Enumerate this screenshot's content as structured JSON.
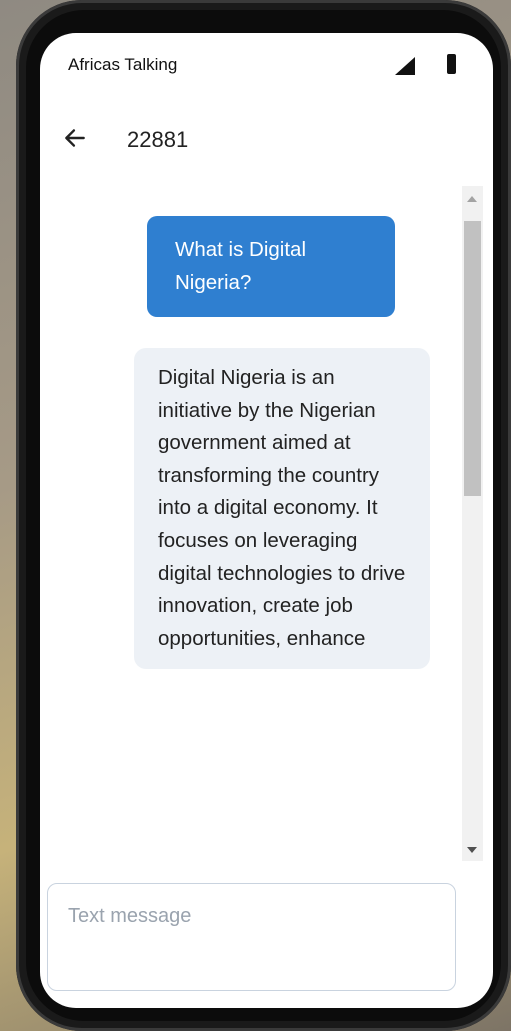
{
  "status_bar": {
    "carrier": "Africas Talking",
    "signal_icon": "signal-icon",
    "battery_icon": "battery-icon"
  },
  "header": {
    "back_icon": "arrow-left-icon",
    "title": "22881"
  },
  "messages": [
    {
      "direction": "outgoing",
      "text": "What is Digital Nigeria?"
    },
    {
      "direction": "incoming",
      "text": "Digital Nigeria is an initiative by the Nigerian government aimed at transforming the country into a digital economy. It focuses on leveraging digital technologies to drive innovation, create job opportunities, enhance"
    }
  ],
  "composer": {
    "placeholder": "Text message",
    "value": ""
  },
  "colors": {
    "outgoing_bubble": "#2f7fd0",
    "incoming_bubble": "#edf1f6",
    "screen_background": "#ffffff"
  }
}
